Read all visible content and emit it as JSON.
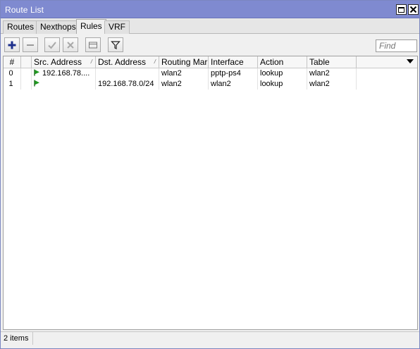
{
  "window": {
    "title": "Route List",
    "title_bar_color": "#7f8ad0"
  },
  "tabs": [
    {
      "label": "Routes",
      "active": false
    },
    {
      "label": "Nexthops",
      "active": false
    },
    {
      "label": "Rules",
      "active": true
    },
    {
      "label": "VRF",
      "active": false
    }
  ],
  "toolbar": {
    "buttons": [
      {
        "name": "add",
        "icon": "plus-icon"
      },
      {
        "name": "remove",
        "icon": "minus-icon"
      },
      {
        "name": "enable",
        "icon": "check-icon"
      },
      {
        "name": "disable",
        "icon": "x-icon"
      },
      {
        "name": "comment",
        "icon": "comment-icon"
      },
      {
        "name": "filter",
        "icon": "filter-icon"
      }
    ],
    "find_placeholder": "Find"
  },
  "table": {
    "columns": [
      "#",
      "",
      "Src. Address",
      "Dst. Address",
      "Routing Mark",
      "Interface",
      "Action",
      "Table"
    ],
    "rows": [
      {
        "num": "0",
        "src": "192.168.78....",
        "dst": "",
        "routing_mark": "wlan2",
        "interface": "pptp-ps4",
        "action": "lookup",
        "table": "wlan2",
        "flag_color": "#1f9a1f"
      },
      {
        "num": "1",
        "src": "",
        "dst": "192.168.78.0/24",
        "routing_mark": "wlan2",
        "interface": "wlan2",
        "action": "lookup",
        "table": "wlan2",
        "flag_color": "#1f9a1f"
      }
    ]
  },
  "status": {
    "items_text": "2 items"
  }
}
